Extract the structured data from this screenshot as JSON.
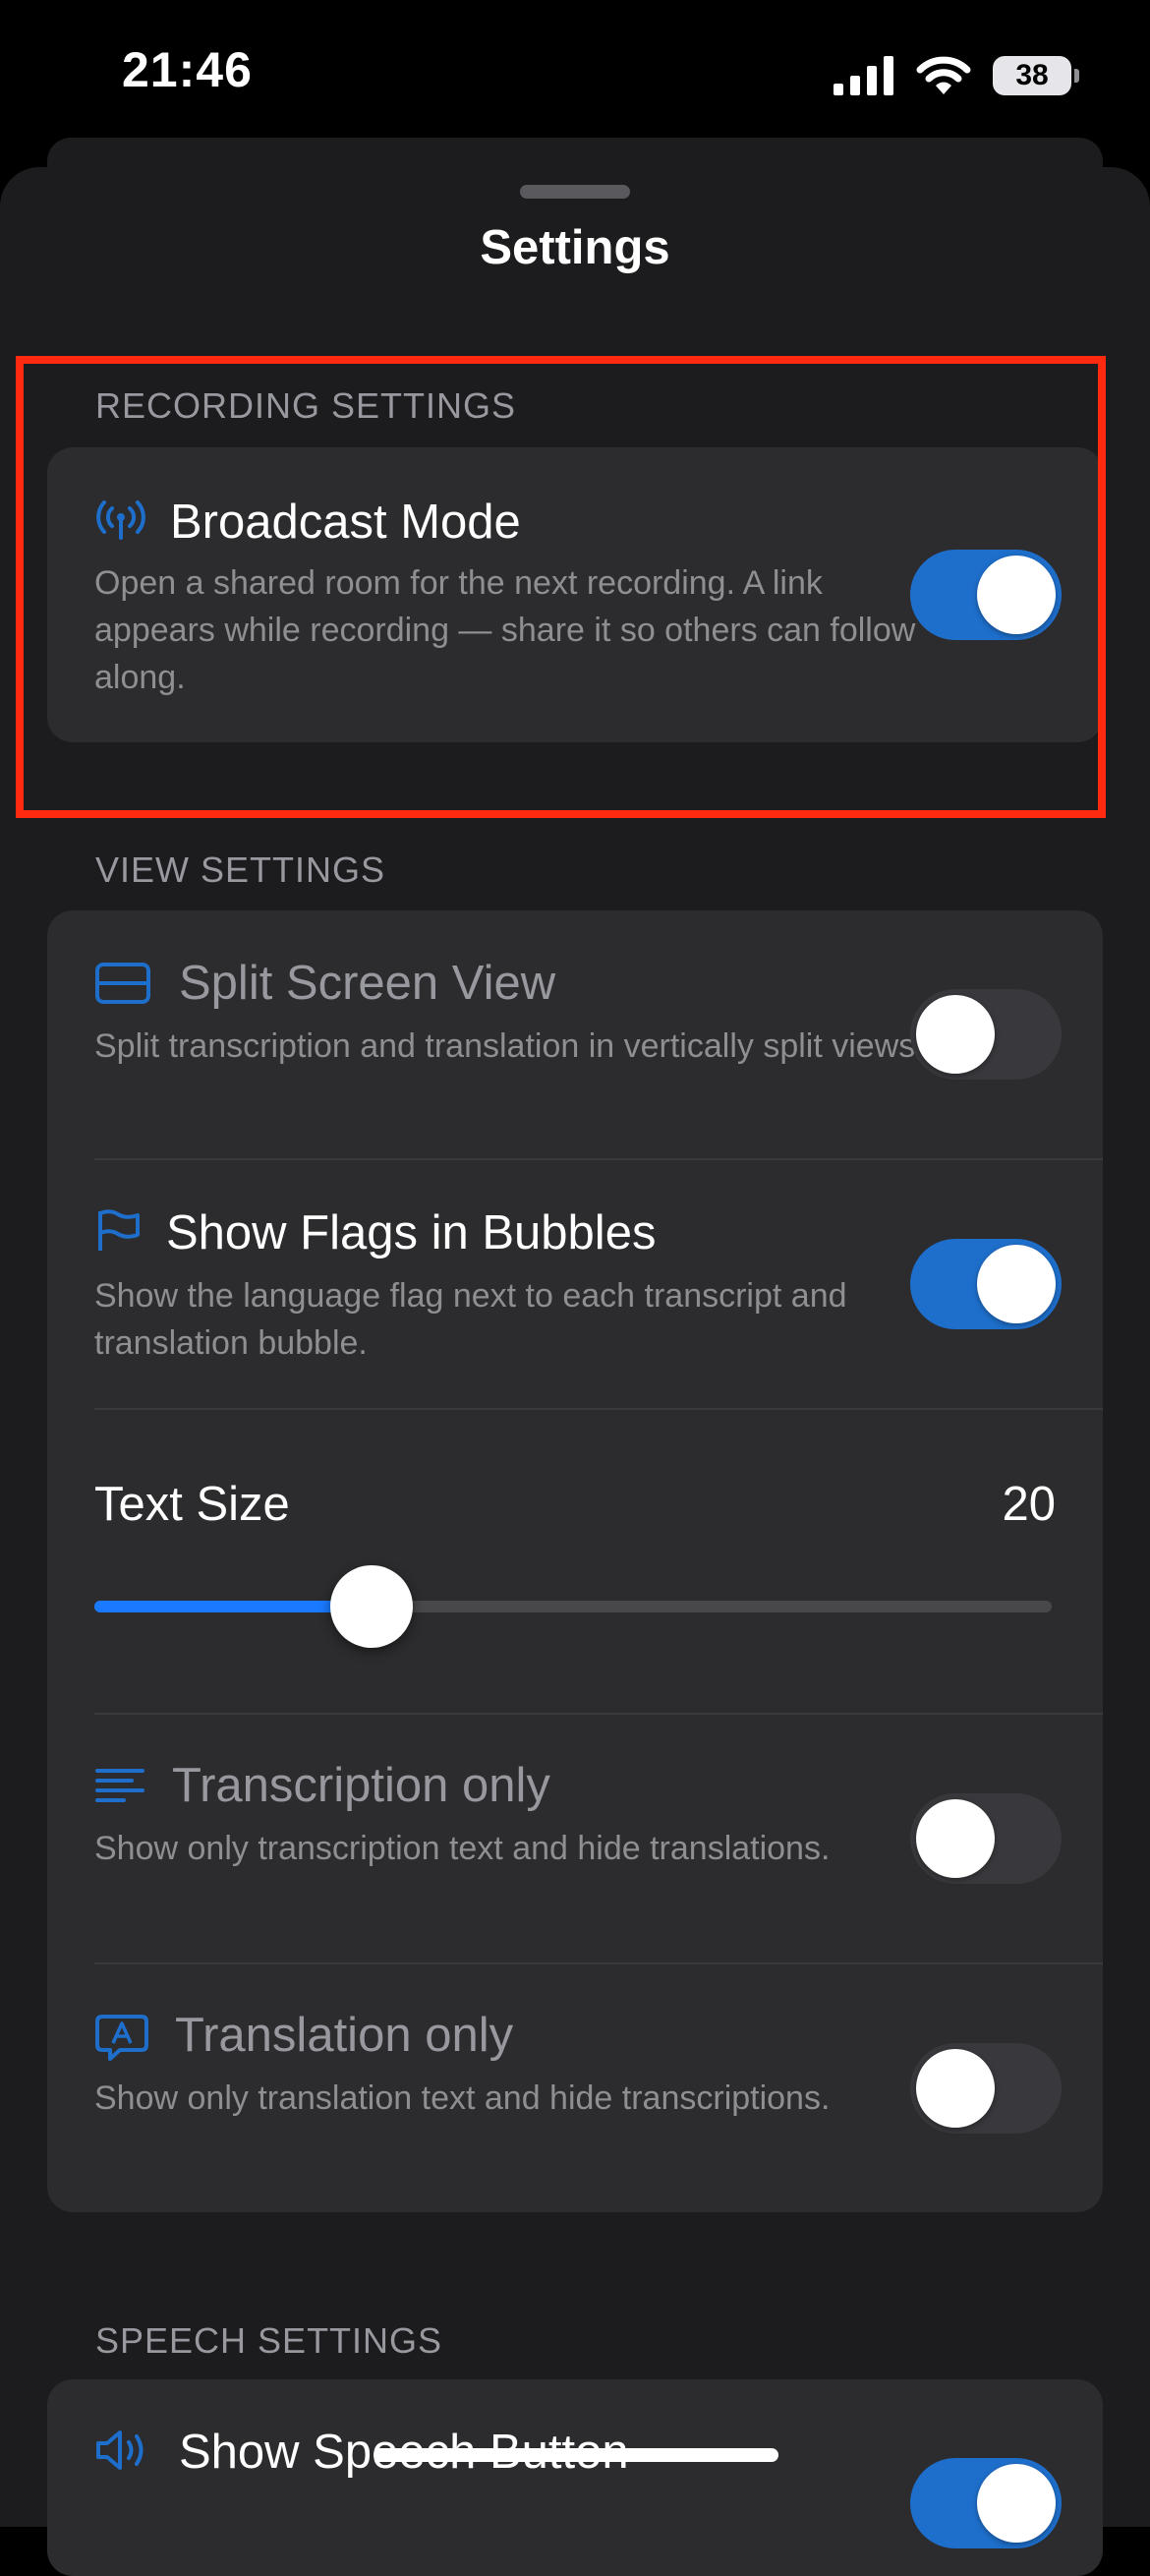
{
  "status_bar": {
    "time": "21:46",
    "battery": "38"
  },
  "sheet": {
    "title": "Settings"
  },
  "recording": {
    "header": "RECORDING SETTINGS",
    "broadcast": {
      "title": "Broadcast Mode",
      "description": "Open a shared room for the next recording. A link appears while recording — share it so others can follow along.",
      "on": true,
      "icon": "broadcast-antenna-icon"
    }
  },
  "view": {
    "header": "VIEW SETTINGS",
    "split_screen": {
      "title": "Split Screen View",
      "description": "Split transcription and translation in vertically split views",
      "on": false,
      "icon": "split-screen-icon"
    },
    "flags": {
      "title": "Show Flags in Bubbles",
      "description": "Show the language flag next to each transcript and translation bubble.",
      "on": true,
      "icon": "flag-icon"
    },
    "text_size": {
      "label": "Text Size",
      "value": "20",
      "slider_fraction": 0.29
    },
    "transcription_only": {
      "title": "Transcription only",
      "description": "Show only transcription text and hide translations.",
      "on": false,
      "icon": "text-lines-icon"
    },
    "translation_only": {
      "title": "Translation only",
      "description": "Show only translation text and hide transcriptions.",
      "on": false,
      "icon": "translate-bubble-icon"
    }
  },
  "speech": {
    "header": "SPEECH SETTINGS",
    "speech_button": {
      "title": "Show Speech Button",
      "on": true,
      "icon": "speaker-icon"
    }
  },
  "colors": {
    "accent": "#1e6fcc",
    "slider_fill": "#1a7aff",
    "highlight": "#ff2a0f"
  }
}
